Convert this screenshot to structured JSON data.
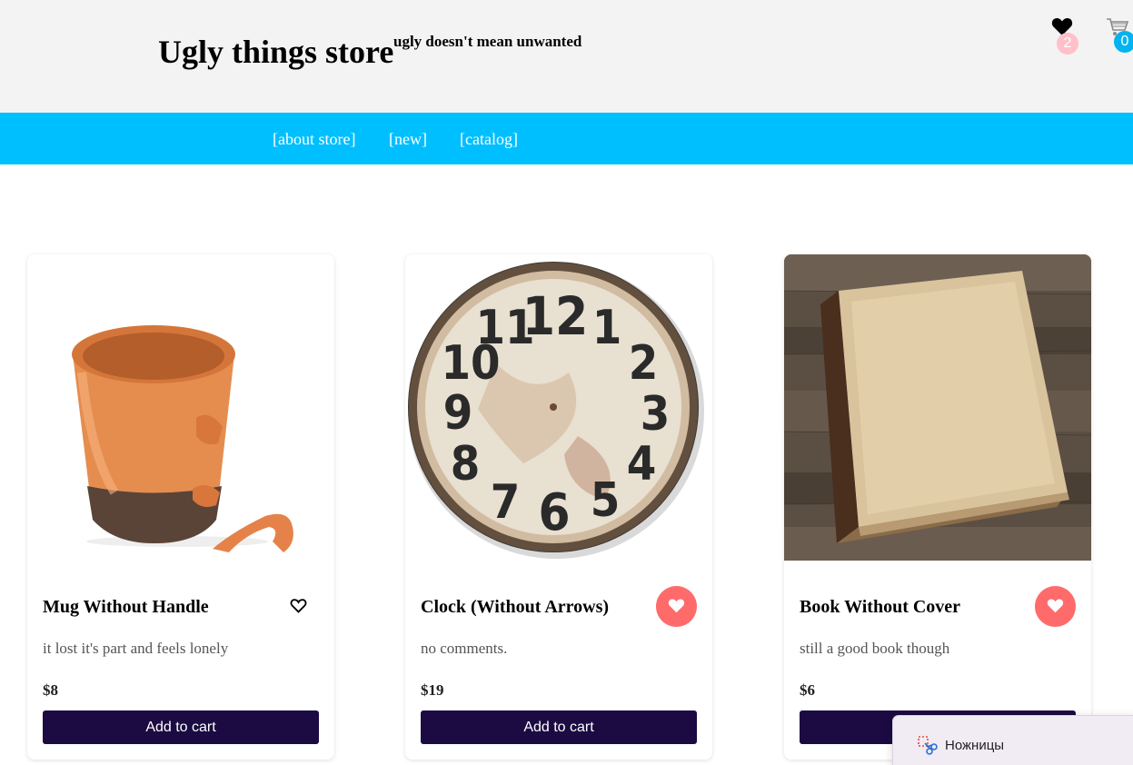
{
  "header": {
    "title": "Ugly things store",
    "tagline": "ugly doesn't mean unwanted",
    "favorites_icon": "heart-icon",
    "favorites_count": "2",
    "cart_icon": "cart-icon",
    "cart_count": "0"
  },
  "nav": {
    "items": [
      {
        "label": "[about store]"
      },
      {
        "label": "[new]"
      },
      {
        "label": "[catalog]"
      }
    ]
  },
  "products": [
    {
      "name": "Mug Without Handle",
      "description": "it lost it's part and feels lonely",
      "price": "$8",
      "add_label": "Add to cart",
      "liked": false,
      "image_icon": "broken-mug-image"
    },
    {
      "name": "Clock (Without Arrows)",
      "description": "no comments.",
      "price": "$19",
      "add_label": "Add to cart",
      "liked": true,
      "image_icon": "clock-face-image",
      "clock_numbers": [
        "12",
        "1",
        "2",
        "3",
        "4",
        "5",
        "6",
        "7",
        "8",
        "9",
        "10",
        "11"
      ]
    },
    {
      "name": "Book Without Cover",
      "description": "still a good book though",
      "price": "$6",
      "add_label": "Add to cart",
      "liked": true,
      "image_icon": "old-book-image"
    }
  ],
  "snipping_tool": {
    "label": "Ножницы",
    "icon": "scissors-icon"
  },
  "colors": {
    "header_bg": "#f3f3f3",
    "nav_bg": "#00bfff",
    "button_bg": "#1b0b42",
    "like_active": "#ff6b6b",
    "fav_badge": "#ffc0cb",
    "cart_badge": "#00b4f0"
  }
}
